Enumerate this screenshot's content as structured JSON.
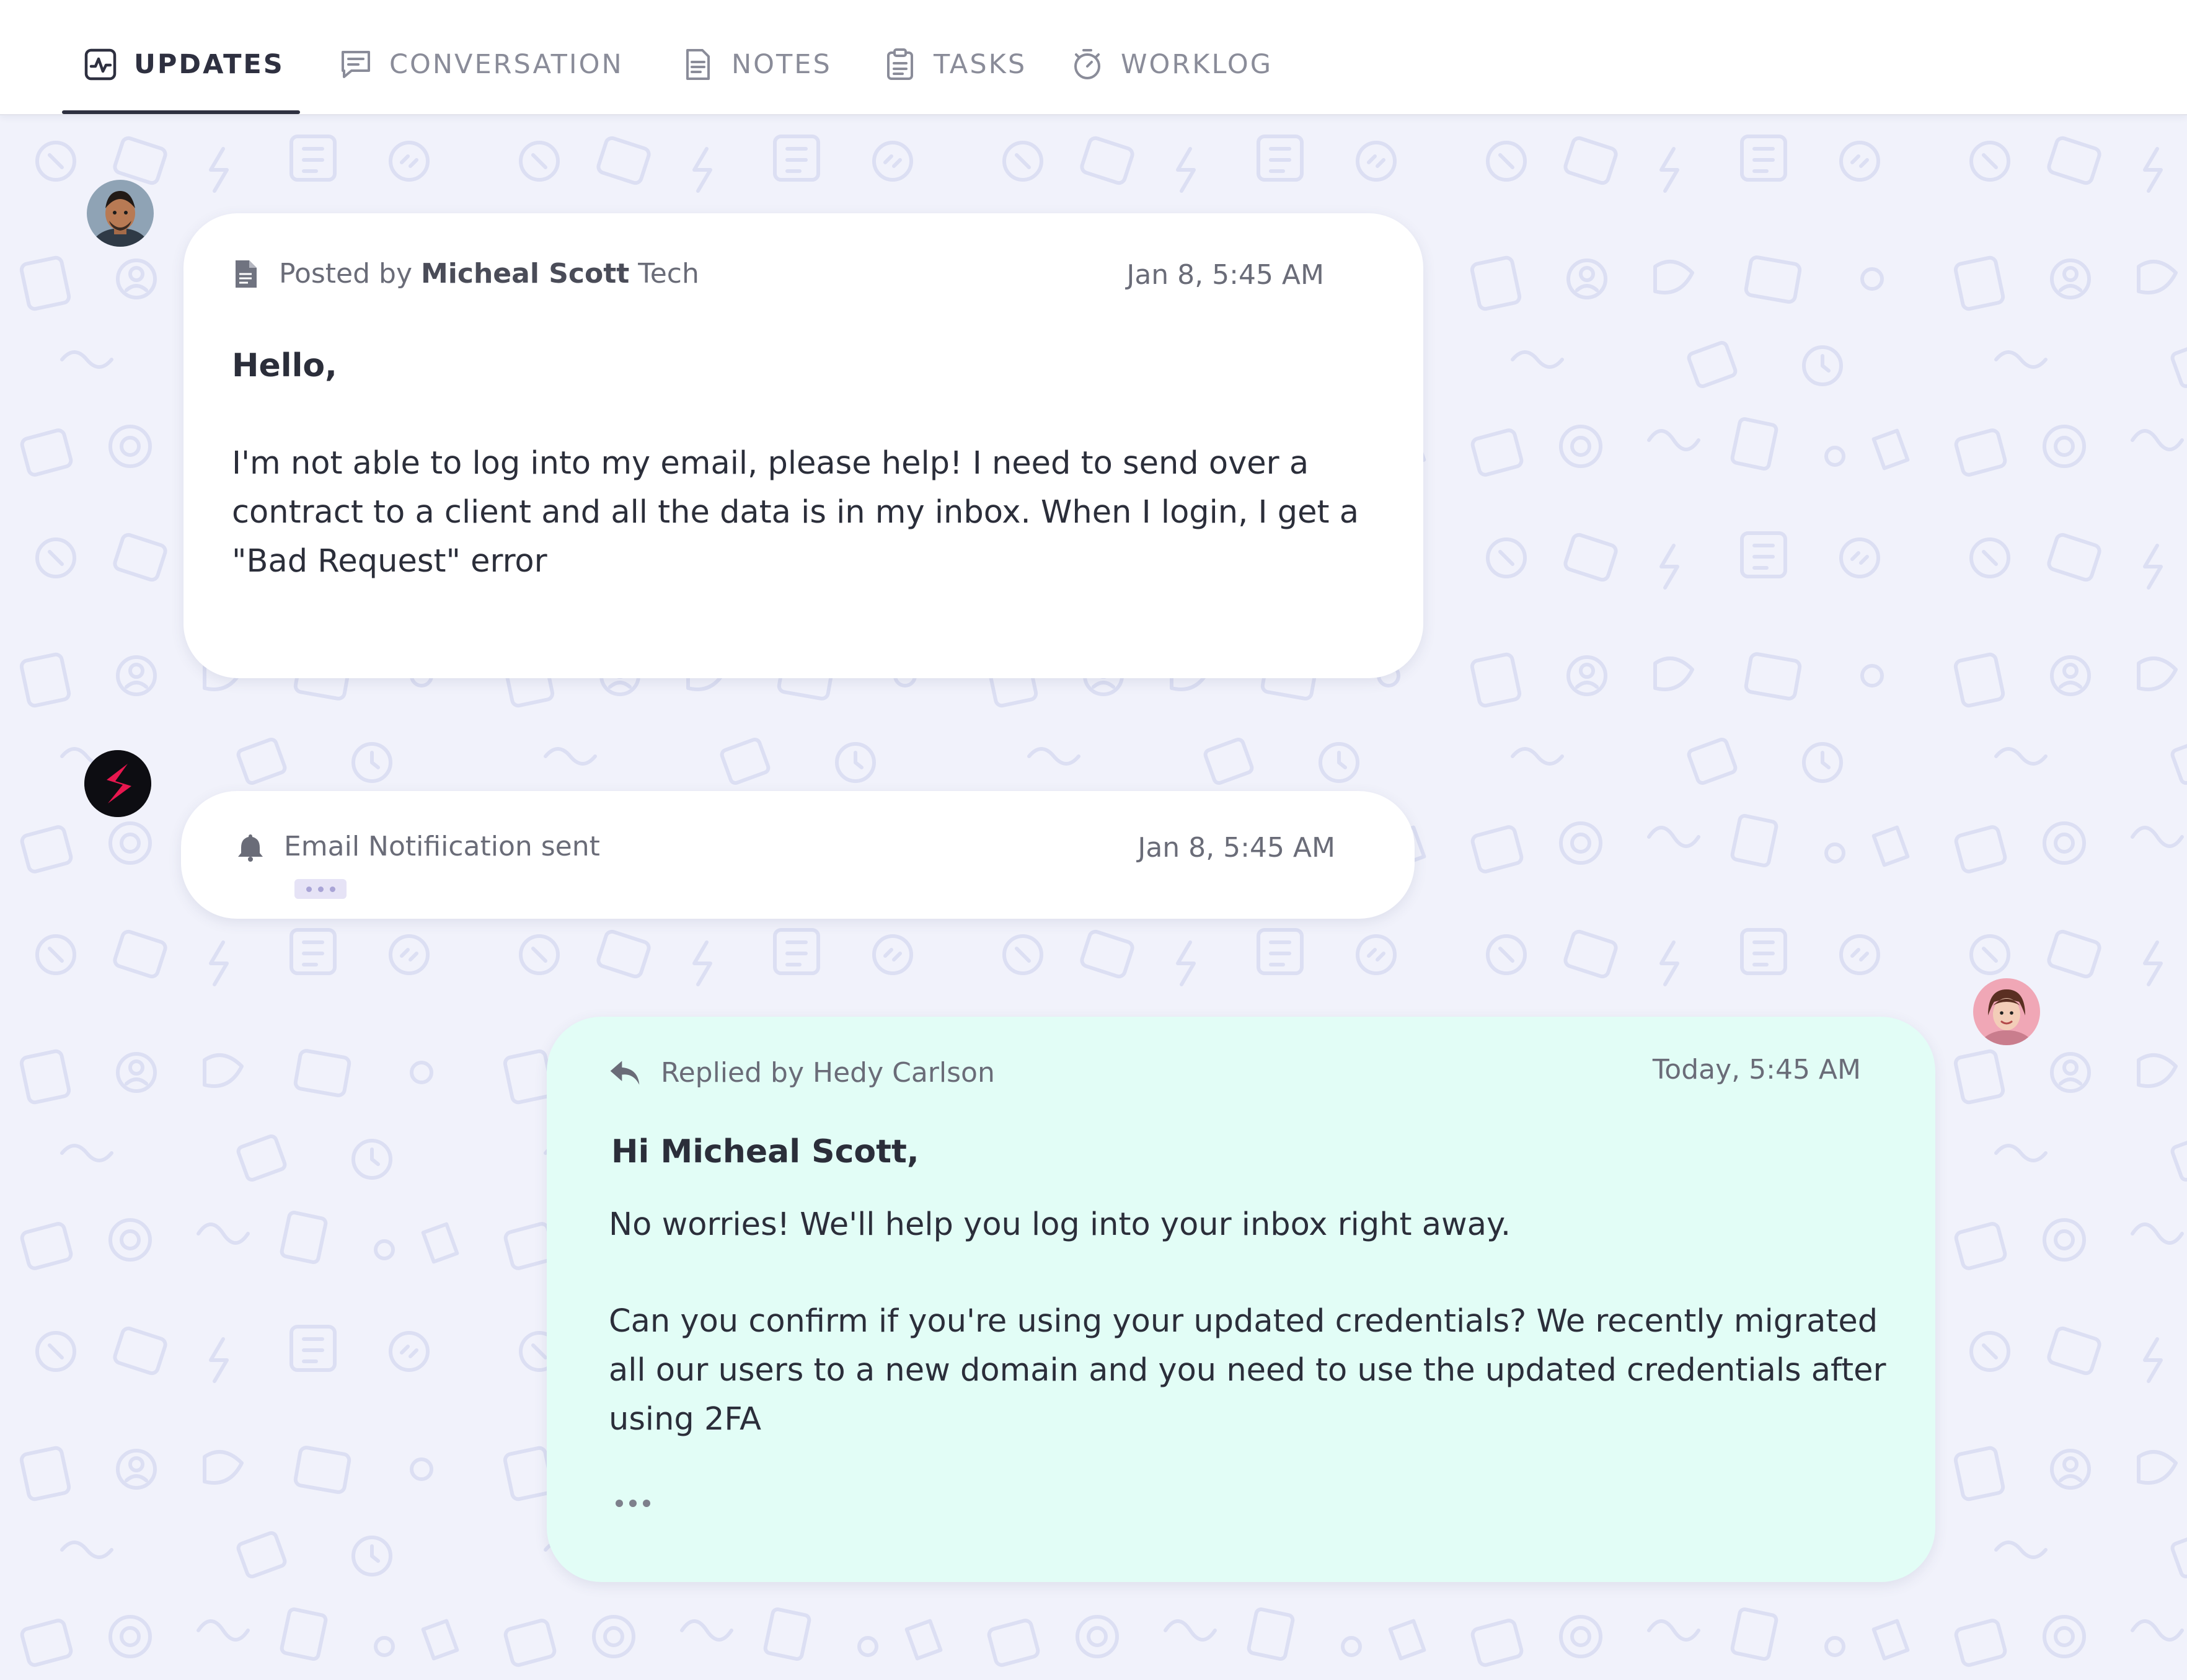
{
  "tabs": [
    {
      "label": "UPDATES",
      "icon": "activity-icon",
      "active": true
    },
    {
      "label": "CONVERSATION",
      "icon": "chat-icon",
      "active": false
    },
    {
      "label": "NOTES",
      "icon": "note-icon",
      "active": false
    },
    {
      "label": "TASKS",
      "icon": "clipboard-icon",
      "active": false
    },
    {
      "label": "WORKLOG",
      "icon": "stopwatch-icon",
      "active": false
    }
  ],
  "post": {
    "prefix": "Posted by",
    "author": "Micheal Scott",
    "suffix": "Tech",
    "time": "Jan 8, 5:45 AM",
    "greeting": "Hello,",
    "body": "I'm not able to log into my email, please help! I need to send over a\ncontract to a client and all the data is in my inbox. When I login, I get a\n\"Bad Request\" error",
    "icon": "document-icon"
  },
  "notification": {
    "text": "Email Notifiication sent",
    "time": "Jan 8, 5:45 AM",
    "icon": "bell-icon"
  },
  "reply": {
    "label": "Replied by Hedy Carlson",
    "time": "Today, 5:45 AM",
    "greeting": "Hi Micheal Scott,",
    "line1": "No worries! We'll help you log into your inbox right away.",
    "body": "Can you confirm if you're using your updated credentials? We recently migrated\nall our users to a new domain and you need to use the updated credentials after\nusing 2FA",
    "icon": "reply-icon"
  },
  "colors": {
    "background": "#f1f2fb",
    "pattern": "#dcdff3",
    "reply_card": "#e2fdf6",
    "brand_logo": "#e8174f",
    "active_tab": "#2e3040"
  }
}
